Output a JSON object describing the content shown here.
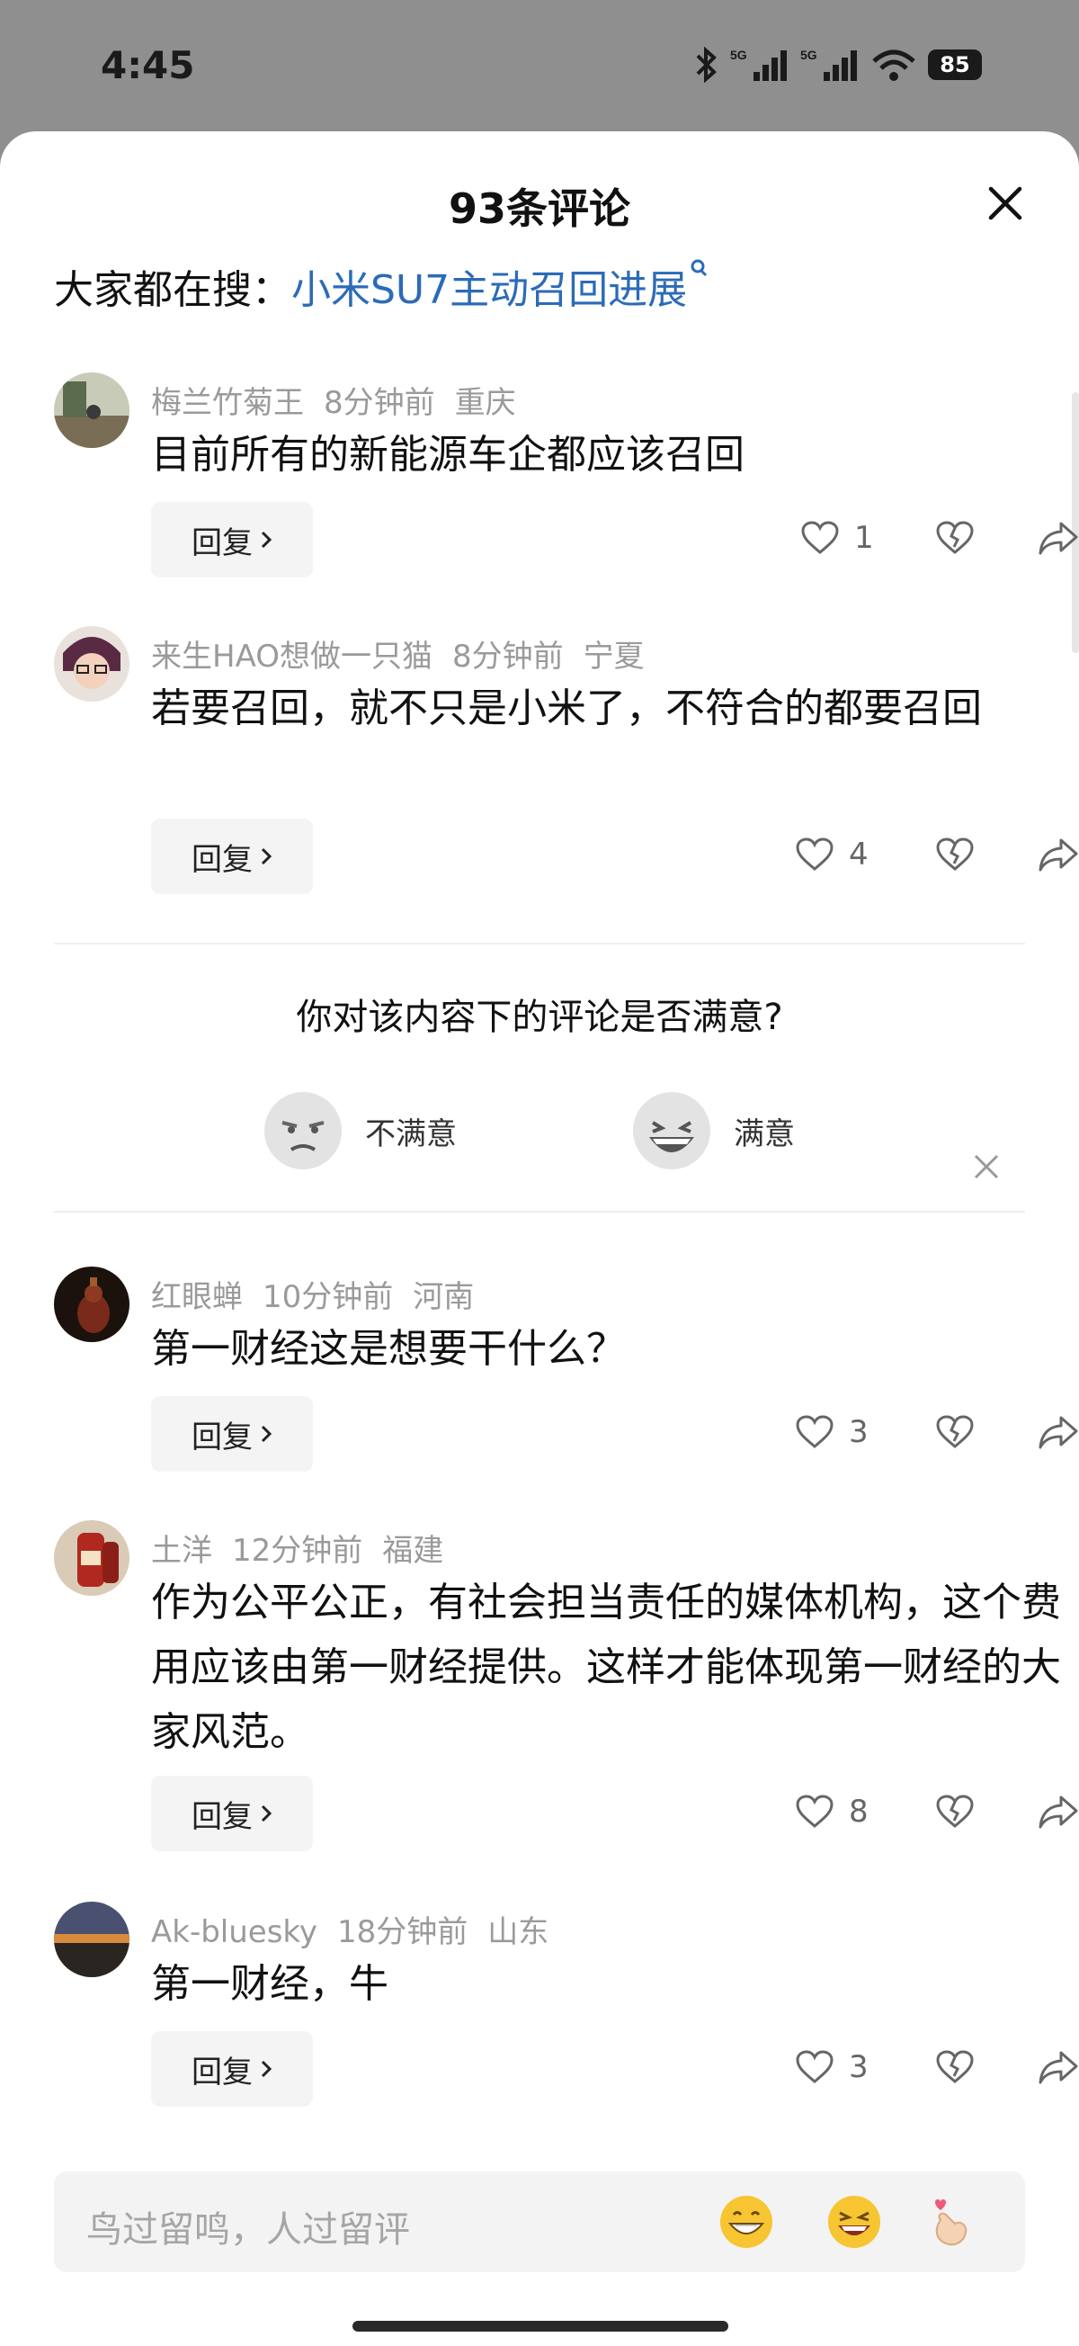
{
  "status_bar": {
    "time": "4:45",
    "battery": "85",
    "network": "5G"
  },
  "sheet": {
    "title": "93条评论",
    "everyone_searching_label": "大家都在搜：",
    "everyone_searching_link": "小米SU7主动召回进展"
  },
  "comments": [
    {
      "user": "梅兰竹菊王",
      "time": "8分钟前",
      "location": "重庆",
      "text": "目前所有的新能源车企都应该召回",
      "reply_label": "回复",
      "likes": "1"
    },
    {
      "user": "来生HAO想做一只猫",
      "time": "8分钟前",
      "location": "宁夏",
      "text": "若要召回，就不只是小米了，不符合的都要召回",
      "reply_label": "回复",
      "likes": "4"
    },
    {
      "user": "红眼蝉",
      "time": "10分钟前",
      "location": "河南",
      "text": "第一财经这是想要干什么？",
      "reply_label": "回复",
      "likes": "3"
    },
    {
      "user": "土洋",
      "time": "12分钟前",
      "location": "福建",
      "text": "作为公平公正，有社会担当责任的媒体机构，这个费用应该由第一财经提供。这样才能体现第一财经的大家风范。",
      "reply_label": "回复",
      "likes": "8"
    },
    {
      "user": "Ak-bluesky",
      "time": "18分钟前",
      "location": "山东",
      "text": "第一财经，牛",
      "reply_label": "回复",
      "likes": "3"
    }
  ],
  "survey": {
    "question": "你对该内容下的评论是否满意?",
    "option_unsatisfied": "不满意",
    "option_satisfied": "满意"
  },
  "input": {
    "placeholder": "鸟过留鸣，人过留评"
  },
  "colors": {
    "link": "#2c6bb8",
    "meta": "#9a9a9a",
    "backdrop": "#8f8f8f"
  }
}
